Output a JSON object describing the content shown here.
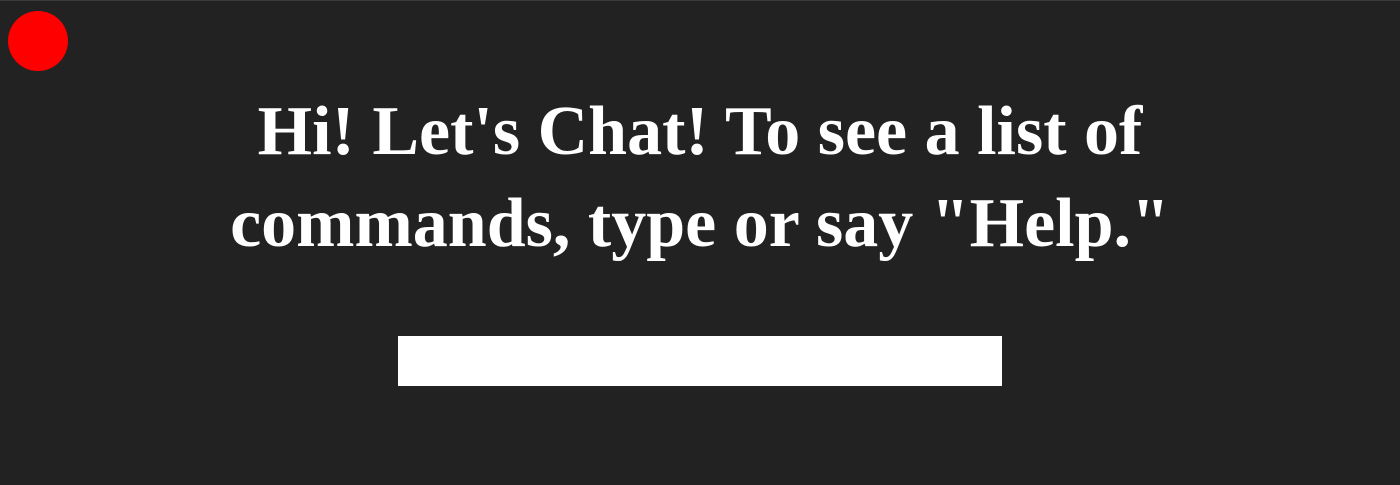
{
  "colors": {
    "background": "#222222",
    "accent": "#ff0000",
    "text": "#ffffff",
    "input_background": "#ffffff"
  },
  "mic": {
    "icon": "red-circle-record-icon",
    "state": "recording"
  },
  "greeting": {
    "text": "Hi! Let's Chat! To see a list of commands, type or say \"Help.\""
  },
  "chat": {
    "input_value": "",
    "placeholder": ""
  }
}
